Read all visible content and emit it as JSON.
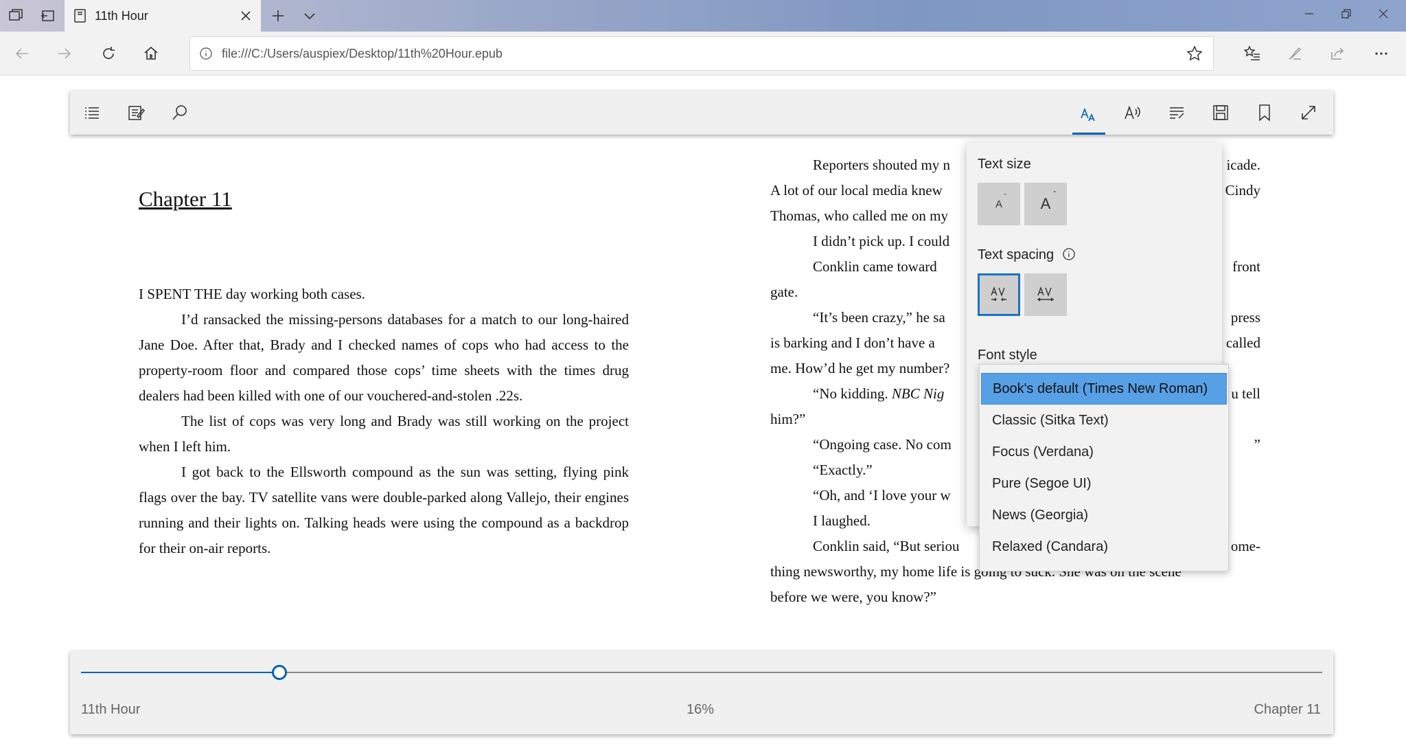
{
  "browser": {
    "tab_title": "11th Hour",
    "url": "file:///C:/Users/auspiex/Desktop/11th%20Hour.epub"
  },
  "icons": {
    "tab_manager": "tab-manager-icon",
    "set_aside": "set-aside-icon",
    "book": "book-icon",
    "close": "close-icon",
    "new_tab": "plus-icon",
    "tab_list": "chevron-down-icon",
    "back": "arrow-left-icon",
    "forward": "arrow-right-icon",
    "refresh": "refresh-icon",
    "home": "home-icon",
    "info": "info-icon",
    "favorite": "star-icon",
    "favorites_hub": "favorites-list-icon",
    "notes": "pen-icon",
    "share": "share-icon",
    "more": "ellipsis-icon",
    "toc": "list-icon",
    "notes_list": "notes-icon",
    "search": "search-icon",
    "text_options": "text-options-icon",
    "read_aloud": "read-aloud-icon",
    "grammar": "grammar-tools-icon",
    "save": "save-icon",
    "bookmark": "bookmark-icon",
    "fullscreen": "fullscreen-icon"
  },
  "colors": {
    "accent": "#0063b1",
    "selected_font": "#57a0e6"
  },
  "book": {
    "left_page": {
      "chapter_title": "Chapter 11",
      "paragraphs": [
        "I SPENT THE day working both cases.",
        "I’d ransacked the missing-persons databases for a match to our long-haired Jane Doe. After that, Brady and I checked names of cops who had access to the property-room floor and compared those cops’ time sheets with the times drug dealers had been killed with one of our vouchered-and-stolen .22s.",
        "The list of cops was very long and Brady was still working on the project when I left him.",
        "I got back to the Ellsworth compound as the sun was setting, flying pink flags over the bay. TV satellite vans were double-parked along Vallejo, their engines running and their lights on. Talking heads were using the compound as a backdrop for their on-air reports."
      ]
    },
    "right_page": {
      "lines": [
        {
          "l": "Reporters shouted my n",
          "r": "icade.",
          "ind": true
        },
        {
          "l": "A lot of our local media knew",
          "r": "Cindy",
          "ind": false
        },
        {
          "l": "Thomas, who called me on my",
          "r": "",
          "ind": false
        },
        {
          "l": "I didn’t pick up. I could",
          "r": "",
          "ind": true
        },
        {
          "l": "Conklin came toward",
          "r": "front",
          "ind": true
        },
        {
          "l": "gate.",
          "r": "",
          "ind": false
        },
        {
          "l": "“It’s been crazy,” he sa",
          "r": "press",
          "ind": true
        },
        {
          "l": "is barking and I don’t have a",
          "r": "called",
          "ind": false
        },
        {
          "l": "me. How’d he get my number?",
          "r": "",
          "ind": false
        },
        {
          "l": "“No kidding. NBC Nig",
          "r": "u tell",
          "ind": true
        },
        {
          "l": "him?”",
          "r": "",
          "ind": false
        },
        {
          "l": "“Ongoing case. No com",
          "r": "”",
          "ind": true
        },
        {
          "l": "“Exactly.”",
          "r": "",
          "ind": true
        },
        {
          "l": "“Oh, and ‘I love your w",
          "r": "",
          "ind": true
        },
        {
          "l": "I laughed.",
          "r": "",
          "ind": true
        },
        {
          "l": "Conklin said, “But seriou",
          "r": "ome-",
          "ind": true
        },
        {
          "l": "thing newsworthy, my home life is going to suck. She was on the scene",
          "r": "",
          "ind": false
        },
        {
          "l": "before we were, you know?”",
          "r": "",
          "ind": false
        }
      ]
    }
  },
  "text_options": {
    "text_size_label": "Text size",
    "text_spacing_label": "Text spacing",
    "font_style_label": "Font style",
    "fonts": [
      "Book's default (Times New Roman)",
      "Classic (Sitka Text)",
      "Focus (Verdana)",
      "Pure (Segoe UI)",
      "News (Georgia)",
      "Relaxed (Candara)"
    ],
    "selected_font_index": 0,
    "spacing_selected": "narrow"
  },
  "footer": {
    "book_title": "11th Hour",
    "progress_label": "16%",
    "progress": 0.16,
    "chapter": "Chapter 11"
  }
}
